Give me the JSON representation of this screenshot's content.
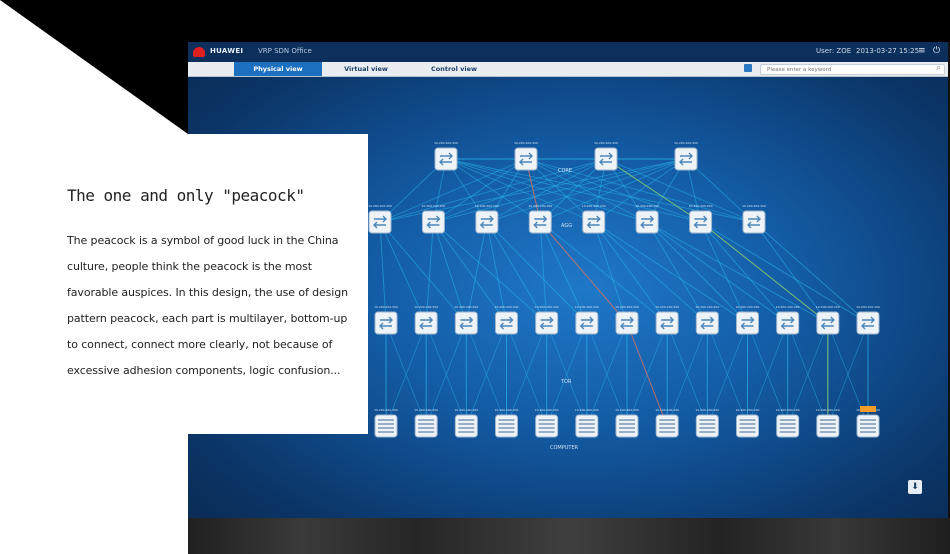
{
  "app": {
    "brand": "HUAWEI",
    "product": "VRP SDN Office",
    "user": "User: ZOE",
    "datetime": "2013-03-27  15:25"
  },
  "tabs": [
    {
      "label": "Physical view",
      "active": true
    },
    {
      "label": "Virtual view",
      "active": false
    },
    {
      "label": "Control view",
      "active": false
    }
  ],
  "search": {
    "placeholder": "Please enter a keyword"
  },
  "layers": {
    "core": "CORE",
    "agg": "AGG",
    "tor": "TOR",
    "computer": "COMPUTER"
  },
  "nodes": {
    "core_count": 4,
    "agg_count": 8,
    "tor_count": 13,
    "computer_count": 13,
    "node_label": "10.200.200.200"
  },
  "icons": {
    "logo": "huawei-logo",
    "calendar": "calendar-icon",
    "search": "search-icon",
    "menu": "menu-icon",
    "power": "power-icon",
    "export": "export-icon"
  },
  "colors": {
    "accent": "#1d6fbf",
    "background": "#135aa3",
    "link": "#27b3e8",
    "link_red": "#d86a5a",
    "link_green": "#8fc85a",
    "alarm": "#f39c2a"
  },
  "card": {
    "title": "The one and only \"peacock\"",
    "body": "The peacock is a symbol of good luck in the China culture, people think the peacock is the most favorable auspices. In this design, the use of design pattern peacock, each part is multilayer, bottom-up to connect, connect more clearly, not because of excessive adhesion components, logic confusion..."
  }
}
